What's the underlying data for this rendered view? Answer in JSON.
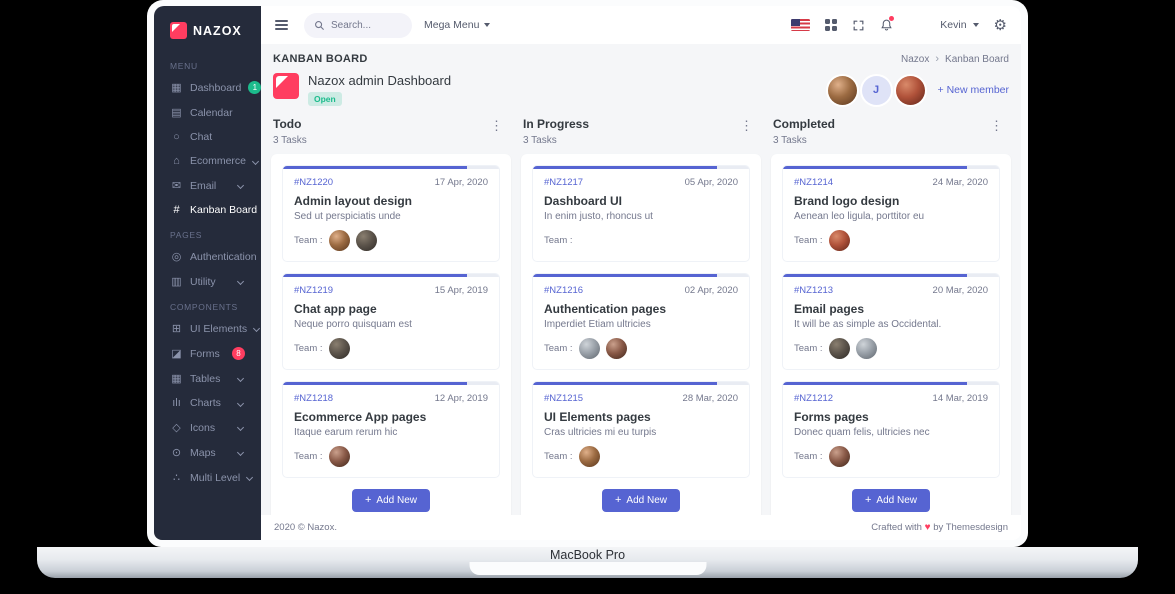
{
  "device": {
    "label": "MacBook Pro"
  },
  "colors": {
    "primary": "#5664d2",
    "success": "#1cbb8c",
    "danger": "#ff3d60",
    "sidebar_bg": "#252b3b",
    "body_bg": "#f5f6f8"
  },
  "sidebar": {
    "logo": "NAZOX",
    "sections": [
      {
        "label": "MENU",
        "items": [
          {
            "label": "Dashboard",
            "badge": "1"
          },
          {
            "label": "Calendar"
          },
          {
            "label": "Chat"
          },
          {
            "label": "Ecommerce"
          },
          {
            "label": "Email"
          },
          {
            "label": "Kanban Board"
          }
        ]
      },
      {
        "label": "PAGES",
        "items": [
          {
            "label": "Authentication"
          },
          {
            "label": "Utility"
          }
        ]
      },
      {
        "label": "COMPONENTS",
        "items": [
          {
            "label": "UI Elements"
          },
          {
            "label": "Forms",
            "badge": "8"
          },
          {
            "label": "Tables"
          },
          {
            "label": "Charts"
          },
          {
            "label": "Icons"
          },
          {
            "label": "Maps"
          },
          {
            "label": "Multi Level"
          }
        ]
      }
    ]
  },
  "topbar": {
    "search_placeholder": "Search...",
    "mega_menu_label": "Mega Menu",
    "user_name": "Kevin"
  },
  "page": {
    "title": "KANBAN BOARD",
    "breadcrumb": {
      "0": "Nazox",
      "1": "Kanban Board"
    },
    "project": {
      "name": "Nazox admin Dashboard",
      "status": "Open"
    },
    "member_initial": "J",
    "new_member_label": "+ New member"
  },
  "board": {
    "team_label": "Team :",
    "add_label": "Add New",
    "columns": [
      {
        "title": "Todo",
        "count": "3 Tasks",
        "cards": [
          {
            "id": "#NZ1220",
            "date": "17 Apr, 2020",
            "title": "Admin layout design",
            "desc": "Sed ut perspiciatis unde"
          },
          {
            "id": "#NZ1219",
            "date": "15 Apr, 2019",
            "title": "Chat app page",
            "desc": "Neque porro quisquam est"
          },
          {
            "id": "#NZ1218",
            "date": "12 Apr, 2019",
            "title": "Ecommerce App pages",
            "desc": "Itaque earum rerum hic"
          }
        ]
      },
      {
        "title": "In Progress",
        "count": "3 Tasks",
        "cards": [
          {
            "id": "#NZ1217",
            "date": "05 Apr, 2020",
            "title": "Dashboard UI",
            "desc": "In enim justo, rhoncus ut"
          },
          {
            "id": "#NZ1216",
            "date": "02 Apr, 2020",
            "title": "Authentication pages",
            "desc": "Imperdiet Etiam ultricies"
          },
          {
            "id": "#NZ1215",
            "date": "28 Mar, 2020",
            "title": "UI Elements pages",
            "desc": "Cras ultricies mi eu turpis"
          }
        ]
      },
      {
        "title": "Completed",
        "count": "3 Tasks",
        "cards": [
          {
            "id": "#NZ1214",
            "date": "24 Mar, 2020",
            "title": "Brand logo design",
            "desc": "Aenean leo ligula, porttitor eu"
          },
          {
            "id": "#NZ1213",
            "date": "20 Mar, 2020",
            "title": "Email pages",
            "desc": "It will be as simple as Occidental."
          },
          {
            "id": "#NZ1212",
            "date": "14 Mar, 2019",
            "title": "Forms pages",
            "desc": "Donec quam felis, ultricies nec"
          }
        ]
      }
    ]
  },
  "footer": {
    "left": "2020 © Nazox.",
    "right_prefix": "Crafted with",
    "right_suffix": "by Themesdesign"
  }
}
